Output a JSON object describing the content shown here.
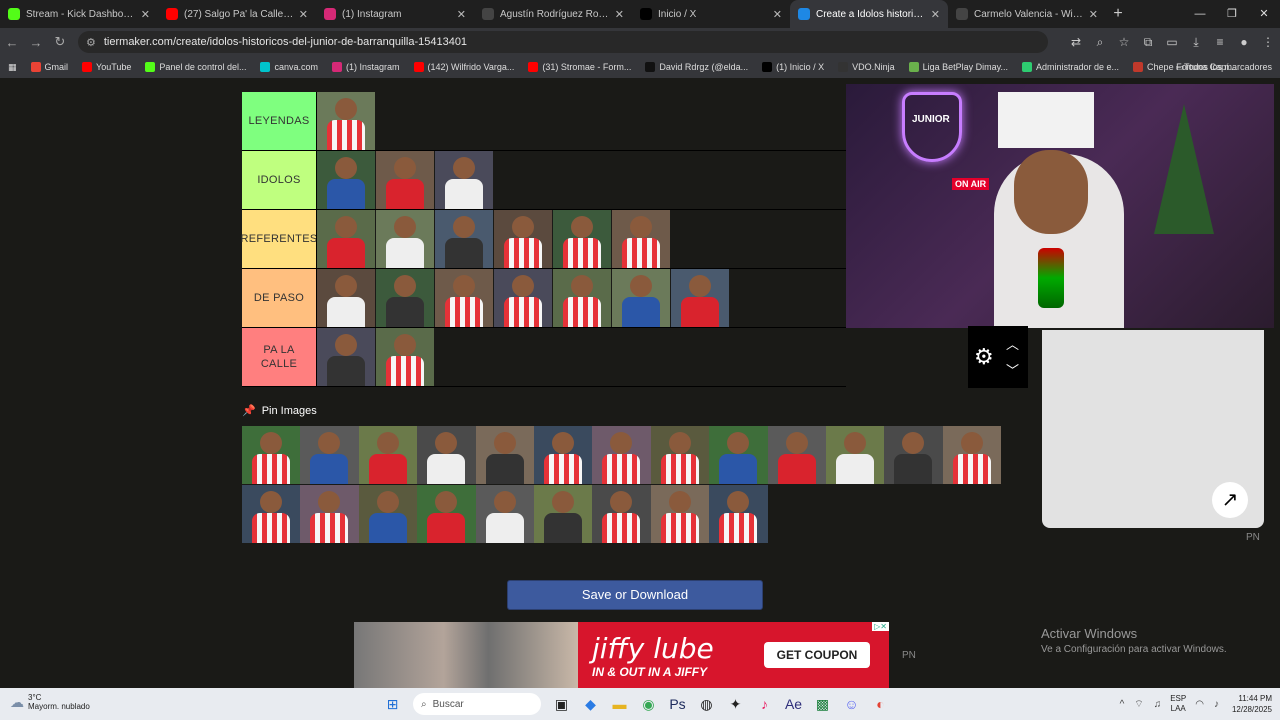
{
  "tabs": [
    {
      "label": "Stream - Kick Dashboard",
      "icon": "kick-icon",
      "color": "#53fc18"
    },
    {
      "label": "(27) Salgo Pa' la Calle - YouTube",
      "icon": "youtube-icon",
      "color": "#ff0000"
    },
    {
      "label": "(1) Instagram",
      "icon": "instagram-icon",
      "color": "#d62976"
    },
    {
      "label": "Agustín Rodríguez Rosano - Wikipedia",
      "icon": "wikipedia-icon",
      "color": "#444444"
    },
    {
      "label": "Inicio / X",
      "icon": "x-icon",
      "color": "#000000"
    },
    {
      "label": "Create a Idolos historicos del Junior",
      "icon": "tiermaker-icon",
      "color": "#1e88e5",
      "active": true
    },
    {
      "label": "Carmelo Valencia - Wikipedia, la",
      "icon": "wikipedia-icon",
      "color": "#444444"
    }
  ],
  "address": {
    "url": "tiermaker.com/create/idolos-historicos-del-junior-de-barranquilla-15413401"
  },
  "bookmarks": [
    {
      "label": "Gmail",
      "color": "#ea4335"
    },
    {
      "label": "YouTube",
      "color": "#ff0000"
    },
    {
      "label": "Panel de control del...",
      "color": "#53fc18"
    },
    {
      "label": "canva.com",
      "color": "#00c4cc"
    },
    {
      "label": "(1) Instagram",
      "color": "#d62976"
    },
    {
      "label": "(142) Wilfrido Varga...",
      "color": "#ff0000"
    },
    {
      "label": "(31) Stromae - Form...",
      "color": "#ff0000"
    },
    {
      "label": "David Rdrgz (@elda...",
      "color": "#111111"
    },
    {
      "label": "(1) Inicio / X",
      "color": "#000000"
    },
    {
      "label": "VDO.Ninja",
      "color": "#333333"
    },
    {
      "label": "Liga BetPlay Dimay...",
      "color": "#6ab04c"
    },
    {
      "label": "Administrador de e...",
      "color": "#2ecc71"
    },
    {
      "label": "Chepe Fortuna Capí...",
      "color": "#c0392b"
    }
  ],
  "all_bookmarks": "Todos los marcadores",
  "tiers": [
    {
      "label": "LEYENDAS",
      "color": "#7fff7f",
      "count": 1
    },
    {
      "label": "IDOLOS",
      "color": "#bfff7f",
      "count": 3
    },
    {
      "label": "REFERENTES",
      "color": "#ffdf7f",
      "count": 6
    },
    {
      "label": "DE PASO",
      "color": "#ffbf7f",
      "count": 7
    },
    {
      "label": "PA LA CALLE",
      "color": "#ff7f7f",
      "count": 2
    }
  ],
  "pin_images_label": "Pin Images",
  "bank_count": 22,
  "save_button": "Save or Download",
  "stream_overlay": {
    "on_air": "ON AIR",
    "neon": "JUNIOR"
  },
  "pip_label": "PN",
  "ad": {
    "brand": "jiffy lube",
    "tagline": "IN & OUT IN A JIFFY",
    "cta": "GET COUPON"
  },
  "pn_label": "PN",
  "activate_windows": {
    "title": "Activar Windows",
    "subtitle": "Ve a Configuración para activar Windows."
  },
  "taskbar": {
    "weather_temp": "3°C",
    "weather_desc": "Mayorm. nublado",
    "search_placeholder": "Buscar",
    "lang": "ESP",
    "lang2": "LAA",
    "time": "11:44 PM",
    "date": "12/28/2025"
  }
}
